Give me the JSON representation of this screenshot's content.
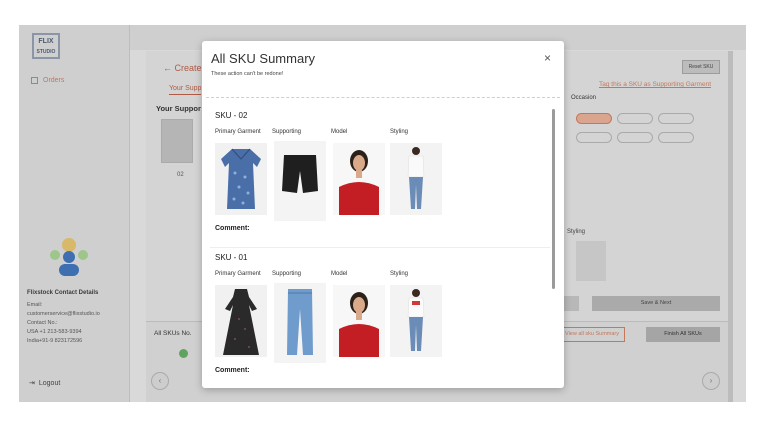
{
  "app": {
    "logo_line1": "FLIX",
    "logo_line2": "STUDIO",
    "sidebar_orders": "Orders",
    "contact_title": "Flixstock Contact Details",
    "contact_lines": [
      "Email:",
      "customerservice@flixstudio.io",
      "Contact No.:",
      "USA +1 213-583-9394",
      "India+91-9 823172596"
    ],
    "logout": "Logout"
  },
  "background": {
    "back_label": "Create",
    "tab_label": "Your Supp",
    "section_label": "Your Suppor",
    "thumb_label": "02",
    "reset_label": "Reset SKU",
    "tag_link": "Tag this a SKU as Supporting Garment",
    "occasion_label": "Occasion",
    "styling_label": "Styling",
    "save_next": "Save & Next",
    "all_skus_label": "All SKUs",
    "all_skus_no": "No.",
    "view_summary": "View all sku Summary",
    "finish": "Finish All SKUs"
  },
  "modal": {
    "title": "All SKU Summary",
    "subtitle": "These action can't be redone!",
    "close": "×",
    "columns": [
      "Primary Garment",
      "Supporting",
      "Model",
      "Styling"
    ],
    "skus": [
      {
        "title": "SKU - 02",
        "comment": "Comment:"
      },
      {
        "title": "SKU - 01",
        "comment": "Comment:"
      }
    ]
  },
  "colors": {
    "accent": "#c3785c",
    "overlay_bg": "#d9d9d9",
    "modal_bg": "#ffffff"
  }
}
